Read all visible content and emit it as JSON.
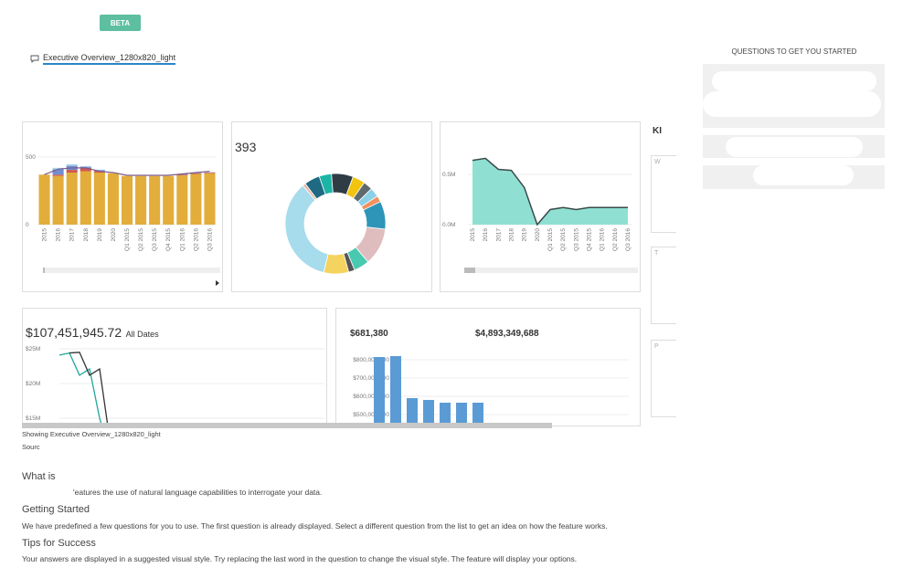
{
  "header": {
    "badge": "BETA",
    "report_link": "Executive Overview_1280x820_light"
  },
  "questions": {
    "title": "QUESTIONS TO GET YOU STARTED"
  },
  "kpi": {
    "title": "KI",
    "boxes": [
      "W",
      "T",
      "P"
    ]
  },
  "chart_data": [
    {
      "type": "bar",
      "stacked": true,
      "categories": [
        "2015",
        "2016",
        "2017",
        "2018",
        "2019",
        "2020",
        "Q1 2015",
        "Q2 2015",
        "Q3 2015",
        "Q4 2015",
        "Q1 2016",
        "Q2 2016",
        "Q3 2016"
      ],
      "series": [
        {
          "values": [
            370,
            360,
            385,
            395,
            385,
            380,
            360,
            360,
            360,
            360,
            365,
            375,
            380
          ],
          "color": "#e2ad3b"
        },
        {
          "values": [
            0,
            10,
            20,
            25,
            12,
            0,
            0,
            0,
            0,
            0,
            5,
            5,
            5
          ],
          "color": "#d0584f"
        },
        {
          "values": [
            0,
            40,
            30,
            8,
            5,
            0,
            0,
            0,
            0,
            0,
            5,
            3,
            2
          ],
          "color": "#6f8fd2"
        },
        {
          "values": [
            0,
            10,
            12,
            5,
            5,
            0,
            0,
            0,
            0,
            0,
            0,
            0,
            0
          ],
          "color": "#a7d3ea"
        }
      ],
      "line": [
        370,
        410,
        420,
        420,
        395,
        385,
        365,
        365,
        365,
        365,
        375,
        385,
        395
      ],
      "line_color": "#7b5a8c",
      "yticks": [
        "0",
        "500"
      ],
      "ylim": [
        0,
        560
      ],
      "grid": true
    },
    {
      "type": "pie",
      "donut": true,
      "total_label": "393",
      "values": [
        4,
        7,
        4,
        3,
        3,
        2,
        9,
        12,
        5,
        2,
        8,
        35,
        1,
        5
      ],
      "colors": [
        "#1bb5a5",
        "#2f3c44",
        "#f1c40f",
        "#5f6a6d",
        "#8ad1e8",
        "#f39160",
        "#2e95b8",
        "#dfbcbe",
        "#48c9b0",
        "#555555",
        "#f4d35e",
        "#a6dcec",
        "#e6b8a9",
        "#1f6a83"
      ]
    },
    {
      "type": "area",
      "categories": [
        "2015",
        "2016",
        "2017",
        "2018",
        "2019",
        "2020",
        "Q1 2015",
        "Q2 2015",
        "Q3 2015",
        "Q4 2015",
        "Q1 2016",
        "Q2 2016",
        "Q3 2016"
      ],
      "values": [
        0.64,
        0.66,
        0.55,
        0.54,
        0.37,
        0,
        0.15,
        0.17,
        0.15,
        0.17,
        0.17,
        0.17,
        0.17
      ],
      "fill": "#8fe0d2",
      "stroke": "#3b4a4a",
      "yticks": [
        "0.0M",
        "0.5M"
      ],
      "ylim": [
        0,
        0.75
      ],
      "grid": true
    },
    {
      "type": "line",
      "headline": "$107,451,945.72",
      "headline_sub": "All Dates",
      "series": [
        {
          "values": [
            24.1,
            24.4,
            21.2,
            22.1,
            15,
            10
          ],
          "color": "#1fa89a"
        },
        {
          "values": [
            24.4,
            24.5,
            21.2,
            22.1,
            12
          ],
          "color": "#333333"
        }
      ],
      "yticks": [
        "$15M",
        "$20M",
        "$25M"
      ],
      "ylim": [
        15,
        25
      ],
      "grid": true
    },
    {
      "type": "bar",
      "headline_left": "$681,380",
      "headline_right": "$4,893,349,688",
      "values": [
        815,
        820,
        590,
        580,
        565,
        565,
        565
      ],
      "color": "#5b9bd5",
      "yticks": [
        "$500,000,000",
        "$600,000,000",
        "$700,000,000",
        "$800,000,000"
      ],
      "ylim": [
        500,
        800
      ],
      "grid": true
    }
  ],
  "footer": {
    "showing": "Showing Executive Overview_1280x820_light",
    "source": "Sourc",
    "what_title": "What is",
    "what_text": "'eatures the use of natural language capabilities to interrogate your data.",
    "getting_title": "Getting Started",
    "getting_text": "We have predefined a few questions for you to use. The first question is already displayed. Select a different question from the list to get an idea on how the feature works.",
    "tips_title": "Tips for Success",
    "tips_text": "Your answers are displayed in a suggested visual style. Try replacing the last word in the question to change the visual style. The feature will display your options."
  }
}
